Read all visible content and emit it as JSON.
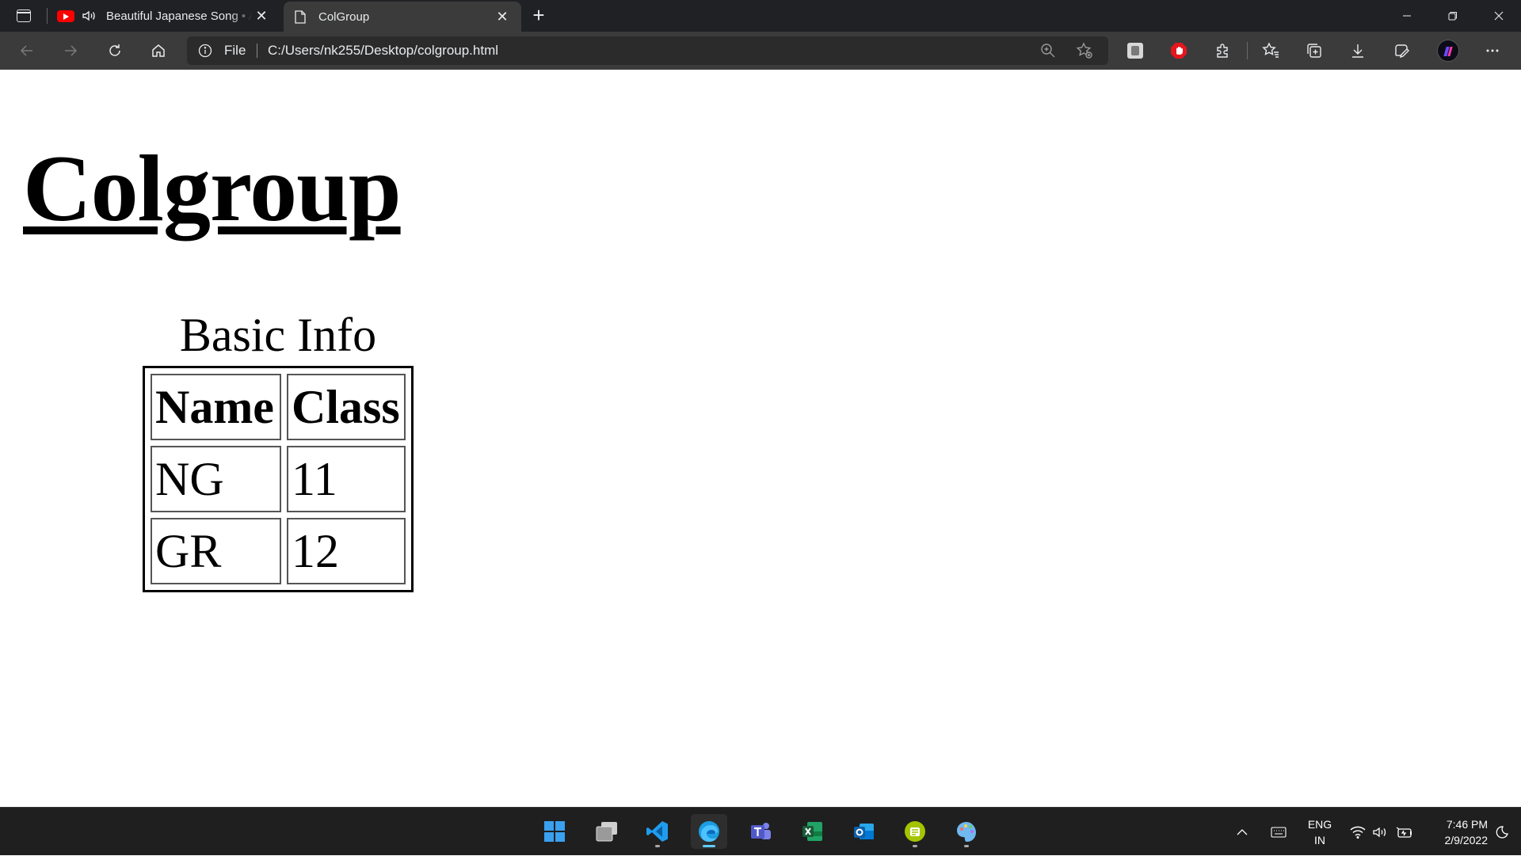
{
  "browser": {
    "tabs": [
      {
        "title": "Beautiful Japanese Song • A",
        "favicon": "youtube-icon",
        "audio": true,
        "active": false
      },
      {
        "title": "ColGroup",
        "favicon": "page-icon",
        "audio": false,
        "active": true
      }
    ],
    "address": {
      "scheme_label": "File",
      "url": "C:/Users/nk255/Desktop/colgroup.html"
    }
  },
  "page": {
    "heading": "Colgroup",
    "table": {
      "caption": "Basic Info",
      "headers": [
        "Name",
        "Class"
      ],
      "rows": [
        [
          "NG",
          "11"
        ],
        [
          "GR",
          "12"
        ]
      ]
    }
  },
  "taskbar": {
    "apps": [
      "windows-start-icon",
      "file-explorer-icon",
      "vscode-icon",
      "edge-icon",
      "teams-icon",
      "excel-icon",
      "outlook-icon",
      "android-app-icon",
      "paint-icon"
    ],
    "language": {
      "line1": "ENG",
      "line2": "IN"
    },
    "time": "7:46 PM",
    "date": "2/9/2022"
  },
  "colors": {
    "titlebar": "#202124",
    "toolbar": "#3b3b3b",
    "taskbar": "#1f1f1f",
    "accent": "#60cdff"
  }
}
